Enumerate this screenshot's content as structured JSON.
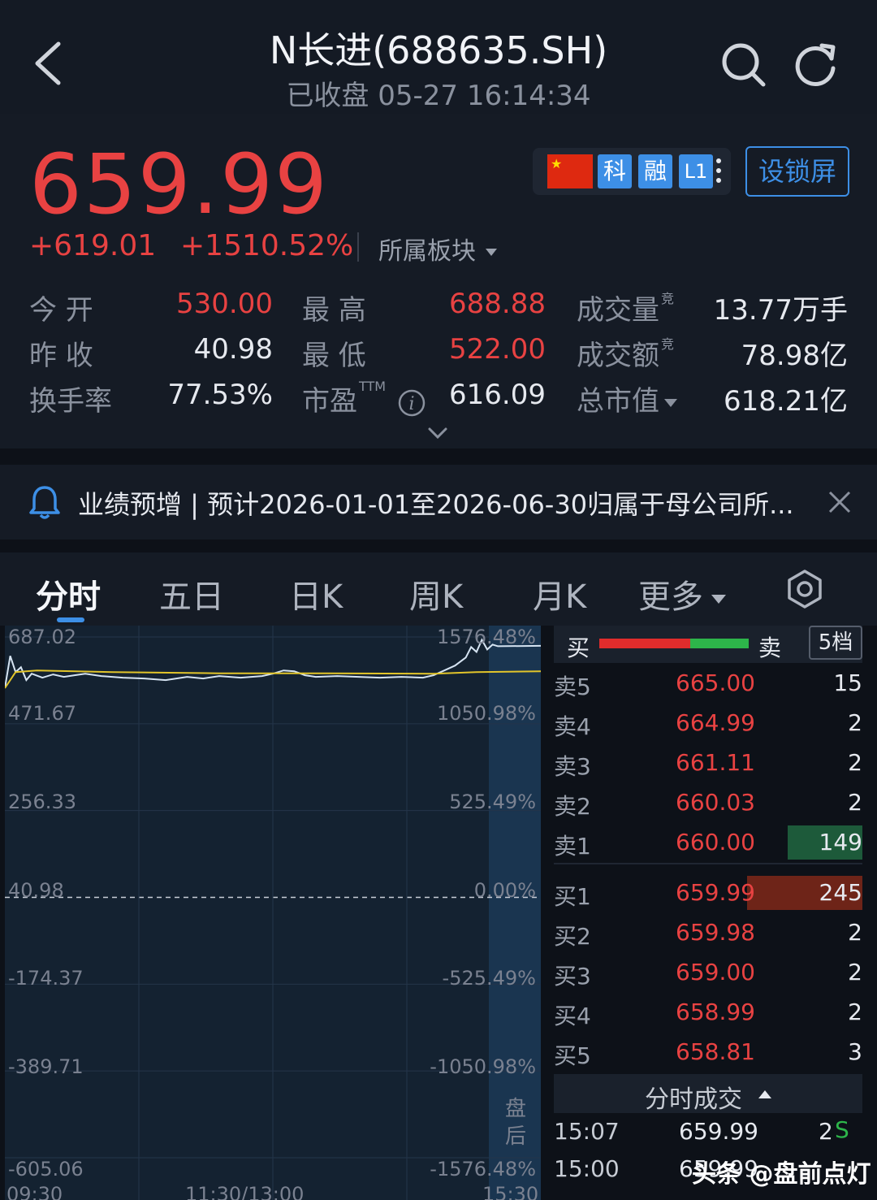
{
  "header": {
    "title": "N长进(688635.SH)",
    "status_time": "已收盘 05-27 16:14:34"
  },
  "quote": {
    "price": "659.99",
    "change": "+619.01",
    "change_pct": "+1510.52%",
    "sector_label": "所属板块",
    "badges": {
      "ke": "科",
      "rong": "融",
      "level": "L1"
    },
    "lock_button": "设锁屏",
    "stats": {
      "open_label": "今 开",
      "open_value": "530.00",
      "high_label": "最 高",
      "high_value": "688.88",
      "volume_label": "成交量",
      "volume_value": "13.77万手",
      "prev_close_label": "昨 收",
      "prev_close_value": "40.98",
      "low_label": "最 低",
      "low_value": "522.00",
      "amount_label": "成交额",
      "amount_value": "78.98亿",
      "turnover_label": "换手率",
      "turnover_value": "77.53%",
      "pe_label": "市盈",
      "pe_sup": "TTM",
      "pe_value": "616.09",
      "mktcap_label": "总市值",
      "mktcap_value": "618.21亿",
      "auction_mark": "竞"
    }
  },
  "notice": {
    "text": "业绩预增 | 预计2026-01-01至2026-06-30归属于母公司所..."
  },
  "tabs": {
    "intraday": "分时",
    "five_day": "五日",
    "day_k": "日K",
    "week_k": "周K",
    "month_k": "月K",
    "more": "更多"
  },
  "chart_data": {
    "type": "line",
    "y_left_ticks": [
      "687.02",
      "471.67",
      "256.33",
      "40.98",
      "-174.37",
      "-389.71",
      "-605.06"
    ],
    "y_right_ticks": [
      "1576.48%",
      "1050.98%",
      "525.49%",
      "0.00%",
      "-525.49%",
      "-1050.98%",
      "-1576.48%"
    ],
    "x_ticks": [
      "09:30",
      "11:30/13:00",
      "15:30"
    ],
    "ylim": [
      -605.06,
      687.02
    ],
    "baseline": 40.98,
    "post_market_label": [
      "盘",
      "后"
    ],
    "series": [
      {
        "x": [
          0,
          0.01,
          0.02,
          0.03,
          0.04,
          0.05,
          0.07,
          0.09,
          0.11,
          0.13,
          0.15,
          0.18,
          0.22,
          0.26,
          0.3,
          0.34,
          0.37,
          0.4,
          0.44,
          0.48,
          0.5,
          0.52,
          0.54,
          0.56,
          0.58,
          0.62,
          0.66,
          0.7,
          0.74,
          0.78,
          0.8,
          0.82,
          0.84,
          0.86,
          0.87,
          0.88,
          0.89,
          0.9,
          0.91,
          0.92,
          1.0
        ],
        "y": [
          560,
          640,
          600,
          612,
          580,
          596,
          586,
          594,
          588,
          592,
          596,
          590,
          586,
          584,
          580,
          588,
          584,
          590,
          586,
          590,
          596,
          604,
          602,
          592,
          588,
          590,
          588,
          586,
          588,
          586,
          592,
          604,
          616,
          636,
          662,
          650,
          680,
          656,
          668,
          664,
          665
        ]
      },
      {
        "x": [
          0,
          0.02,
          0.06,
          0.2,
          0.4,
          0.6,
          0.8,
          0.88,
          1.0
        ],
        "y": [
          560,
          600,
          604,
          600,
          597,
          597,
          596,
          600,
          602
        ]
      }
    ]
  },
  "order_book": {
    "buy_label": "买",
    "sell_label": "卖",
    "levels_button": "5档",
    "asks": [
      {
        "label": "卖5",
        "price": "665.00",
        "volume": "15"
      },
      {
        "label": "卖4",
        "price": "664.99",
        "volume": "2"
      },
      {
        "label": "卖3",
        "price": "661.11",
        "volume": "2"
      },
      {
        "label": "卖2",
        "price": "660.03",
        "volume": "2"
      },
      {
        "label": "卖1",
        "price": "660.00",
        "volume": "149"
      }
    ],
    "bids": [
      {
        "label": "买1",
        "price": "659.99",
        "volume": "245"
      },
      {
        "label": "买2",
        "price": "659.98",
        "volume": "2"
      },
      {
        "label": "买3",
        "price": "659.00",
        "volume": "2"
      },
      {
        "label": "买4",
        "price": "658.99",
        "volume": "2"
      },
      {
        "label": "买5",
        "price": "658.81",
        "volume": "3"
      }
    ]
  },
  "ticks": {
    "title": "分时成交",
    "rows": [
      {
        "time": "15:07",
        "price": "659.99",
        "volume": "2",
        "side": "S"
      },
      {
        "time": "15:00",
        "price": "659.99",
        "volume": "",
        "side": ""
      }
    ]
  },
  "watermark": "头条 @盘前点灯",
  "colors": {
    "up": "#e84242",
    "down": "#2db54a",
    "accent": "#3d8fe6",
    "price_line": "#d6e4f2",
    "avg_line": "#e2c52a"
  }
}
